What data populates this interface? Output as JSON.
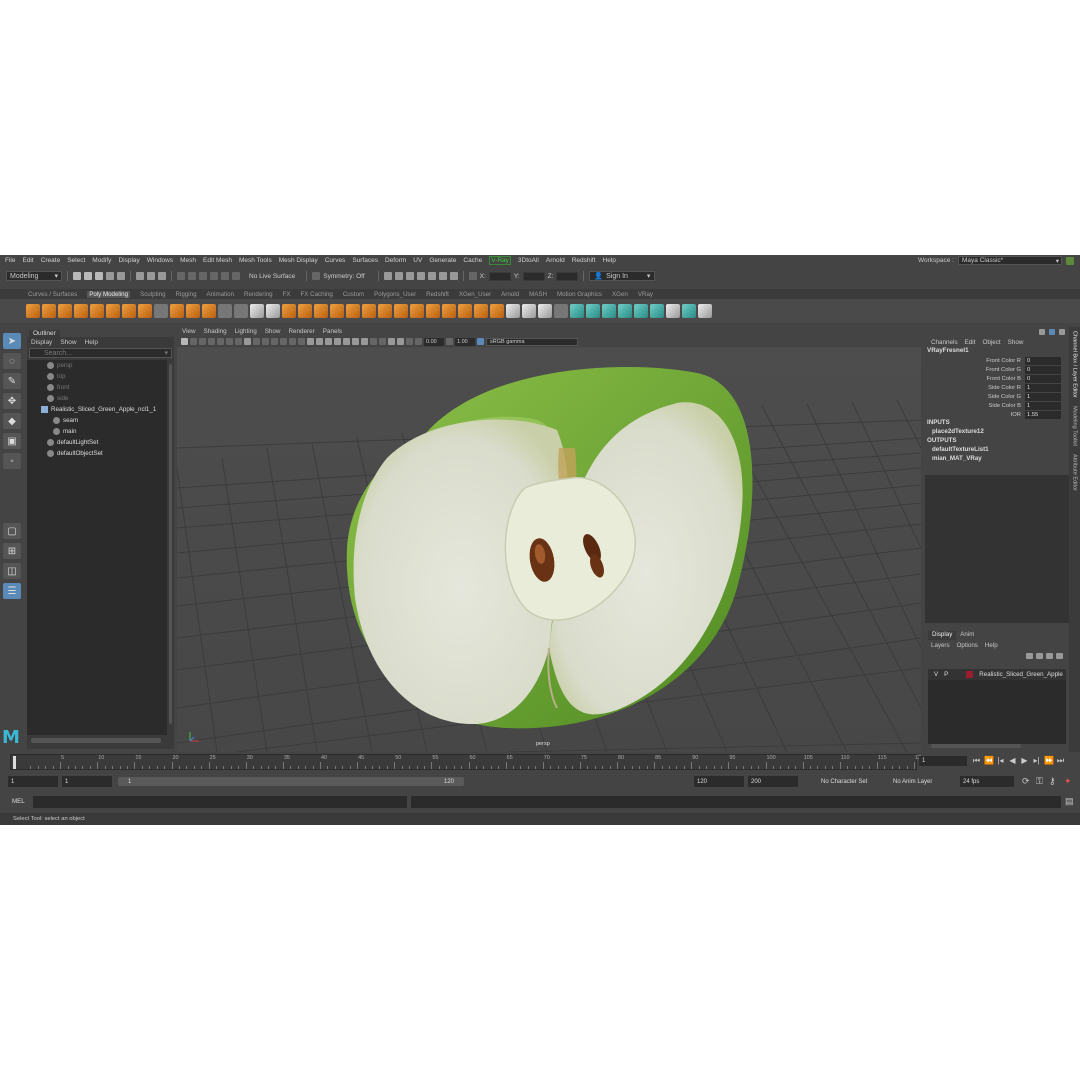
{
  "menubar": {
    "items": [
      "File",
      "Edit",
      "Create",
      "Select",
      "Modify",
      "Display",
      "Windows",
      "Mesh",
      "Edit Mesh",
      "Mesh Tools",
      "Mesh Display",
      "Curves",
      "Surfaces",
      "Deform",
      "UV",
      "Generate",
      "Cache",
      "V-Ray",
      "3DtoAll",
      "Arnold",
      "Redshift",
      "Help"
    ],
    "workspace_label": "Workspace :",
    "workspace_value": "Maya Classic*"
  },
  "statusline": {
    "menuset": "Modeling",
    "live_surface": "No Live Surface",
    "symmetry": "Symmetry: Off",
    "x_label": "X:",
    "y_label": "Y:",
    "z_label": "Z:",
    "sign_in": "Sign In"
  },
  "shelf": {
    "tabs": [
      "Curves / Surfaces",
      "Poly Modeling",
      "Sculpting",
      "Rigging",
      "Animation",
      "Rendering",
      "FX",
      "FX Caching",
      "Custom",
      "Polygons_User",
      "Redshift",
      "XGen_User",
      "Arnold",
      "MASH",
      "Motion Graphics",
      "XGen",
      "VRay"
    ],
    "active_tab": "Poly Modeling"
  },
  "outliner": {
    "title": "Outliner",
    "menu": [
      "Display",
      "Show",
      "Help"
    ],
    "search_placeholder": "Search...",
    "items": [
      {
        "label": "persp",
        "dim": true,
        "indent": 1
      },
      {
        "label": "top",
        "dim": true,
        "indent": 1
      },
      {
        "label": "front",
        "dim": true,
        "indent": 1
      },
      {
        "label": "side",
        "dim": true,
        "indent": 1
      },
      {
        "label": "Realistic_Sliced_Green_Apple_ncl1_1",
        "dim": false,
        "indent": 0
      },
      {
        "label": "seam",
        "dim": false,
        "indent": 2
      },
      {
        "label": "main",
        "dim": false,
        "indent": 2
      },
      {
        "label": "defaultLightSet",
        "dim": false,
        "indent": 1
      },
      {
        "label": "defaultObjectSet",
        "dim": false,
        "indent": 1
      }
    ]
  },
  "viewport": {
    "menu": [
      "View",
      "Shading",
      "Lighting",
      "Show",
      "Renderer",
      "Panels"
    ],
    "exposure": "0.00",
    "gamma": "1.00",
    "color_space": "sRGB gamma",
    "camera_label": "persp"
  },
  "channel_box": {
    "tabs": [
      "Channels",
      "Edit",
      "Object",
      "Show"
    ],
    "node": "VRayFresnel1",
    "attributes": [
      {
        "name": "Front Color R",
        "value": "0"
      },
      {
        "name": "Front Color G",
        "value": "0"
      },
      {
        "name": "Front Color B",
        "value": "0"
      },
      {
        "name": "Side Color R",
        "value": "1"
      },
      {
        "name": "Side Color G",
        "value": "1"
      },
      {
        "name": "Side Color B",
        "value": "1"
      },
      {
        "name": "IOR",
        "value": "1.55"
      }
    ],
    "inputs_label": "INPUTS",
    "inputs": [
      "place2dTexture12"
    ],
    "outputs_label": "OUTPUTS",
    "outputs": [
      "defaultTextureList1",
      "mian_MAT_VRay"
    ]
  },
  "side_tabs": [
    "Channel Box / Layer Editor",
    "Modeling Toolkit",
    "Attribute Editor"
  ],
  "layers": {
    "tabs": [
      "Display",
      "Anim"
    ],
    "menu": [
      "Layers",
      "Options",
      "Help"
    ],
    "row": {
      "v": "V",
      "p": "P",
      "name": "Realistic_Sliced_Green_Apple",
      "color": "#9b1c2c"
    }
  },
  "timeline": {
    "ticks": [
      "5",
      "10",
      "15",
      "20",
      "25",
      "30",
      "35",
      "40",
      "45",
      "50",
      "55",
      "60",
      "65",
      "70",
      "75",
      "80",
      "85",
      "90",
      "95",
      "100",
      "105",
      "110",
      "115",
      "12"
    ],
    "current_frame": "1"
  },
  "range": {
    "start": "1",
    "anim_start": "1",
    "bar_start": "1",
    "bar_end": "120",
    "end": "120",
    "anim_end": "200",
    "character_set": "No Character Set",
    "anim_layer": "No Anim Layer",
    "fps": "24 fps"
  },
  "command": {
    "label": "MEL"
  },
  "help_line": "Select Tool: select an object"
}
